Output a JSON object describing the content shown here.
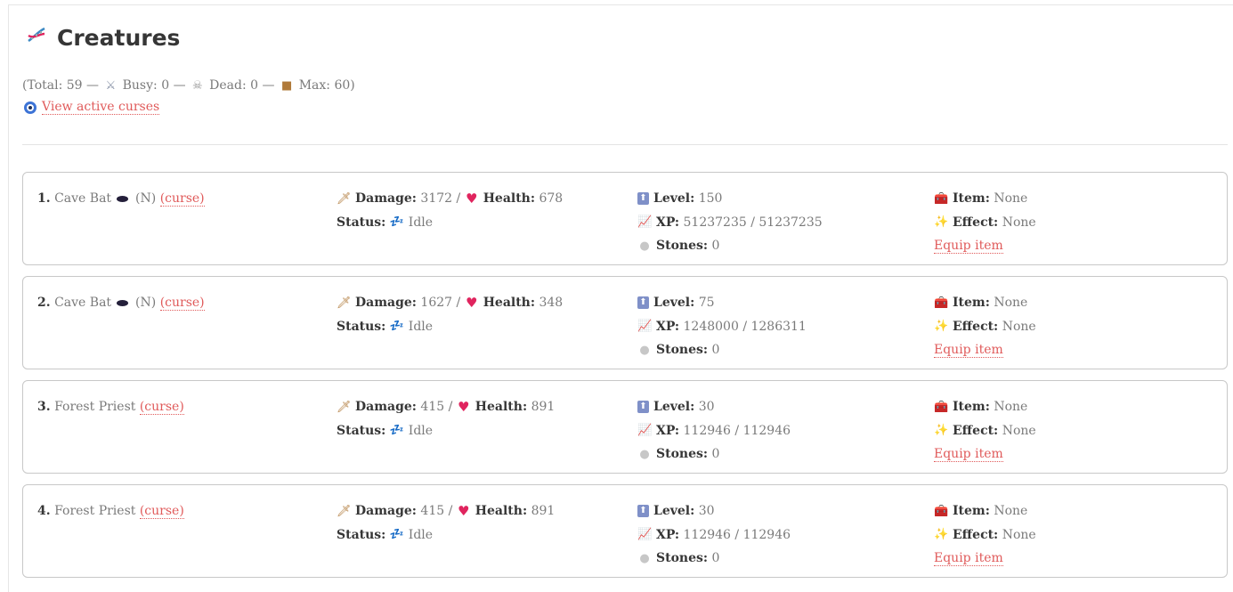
{
  "header": {
    "title": "Creatures"
  },
  "summary": {
    "open": "(Total:",
    "total": "59",
    "busy_label": "Busy:",
    "busy": "0",
    "dead_label": "Dead:",
    "dead": "0",
    "max_label": "Max:",
    "max": "60",
    "close": ")",
    "sep": "—"
  },
  "curses_link": "View active curses",
  "labels": {
    "damage": "Damage:",
    "health": "Health:",
    "status": "Status:",
    "level": "Level:",
    "xp": "XP:",
    "stones": "Stones:",
    "item": "Item:",
    "effect": "Effect:",
    "equip": "Equip item",
    "curse": "(curse)",
    "slash": "/"
  },
  "creatures": [
    {
      "index": "1.",
      "name": "Cave Bat",
      "tag": "(N)",
      "damage": "3172",
      "health": "678",
      "status": "Idle",
      "level": "150",
      "xp": "51237235 / 51237235",
      "stones": "0",
      "item": "None",
      "effect": "None"
    },
    {
      "index": "2.",
      "name": "Cave Bat",
      "tag": "(N)",
      "damage": "1627",
      "health": "348",
      "status": "Idle",
      "level": "75",
      "xp": "1248000 / 1286311",
      "stones": "0",
      "item": "None",
      "effect": "None"
    },
    {
      "index": "3.",
      "name": "Forest Priest",
      "tag": "",
      "damage": "415",
      "health": "891",
      "status": "Idle",
      "level": "30",
      "xp": "112946 / 112946",
      "stones": "0",
      "item": "None",
      "effect": "None"
    },
    {
      "index": "4.",
      "name": "Forest Priest",
      "tag": "",
      "damage": "415",
      "health": "891",
      "status": "Idle",
      "level": "30",
      "xp": "112946 / 112946",
      "stones": "0",
      "item": "None",
      "effect": "None"
    }
  ],
  "colors": {
    "link": "#e05a5a",
    "text": "#7a7a7a",
    "heading": "#363636",
    "border": "#c8c8c8"
  }
}
